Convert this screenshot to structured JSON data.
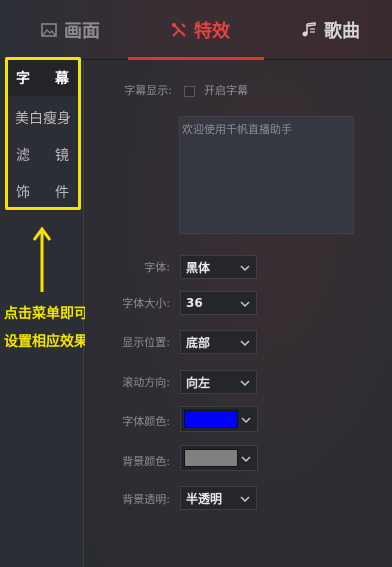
{
  "tabs": {
    "picture": "画面",
    "effects": "特效",
    "songs": "歌曲"
  },
  "sidebar": {
    "items": [
      {
        "label_a": "字",
        "label_b": "幕"
      },
      {
        "label": "美白瘦身"
      },
      {
        "label_a": "滤",
        "label_b": "镜"
      },
      {
        "label_a": "饰",
        "label_b": "件"
      }
    ]
  },
  "annotation": {
    "line1": "点击菜单即可",
    "line2": "设置相应效果"
  },
  "subtitle": {
    "display_label": "字幕显示:",
    "enable_label": "开启字幕",
    "enabled": false,
    "text": "欢迎使用千帆直播助手"
  },
  "settings": {
    "font_label": "字体:",
    "font_value": "黑体",
    "font_size_label": "字体大小:",
    "font_size_value": "36",
    "position_label": "显示位置:",
    "position_value": "底部",
    "scroll_label": "滚动方向:",
    "scroll_value": "向左",
    "font_color_label": "字体颜色:",
    "font_color": "#0000ff",
    "bg_color_label": "背景颜色:",
    "bg_color": "#808080",
    "opacity_label": "背景透明:",
    "opacity_value": "半透明"
  },
  "colors": {
    "accent": "#e0453f",
    "highlight": "#f5e400"
  }
}
